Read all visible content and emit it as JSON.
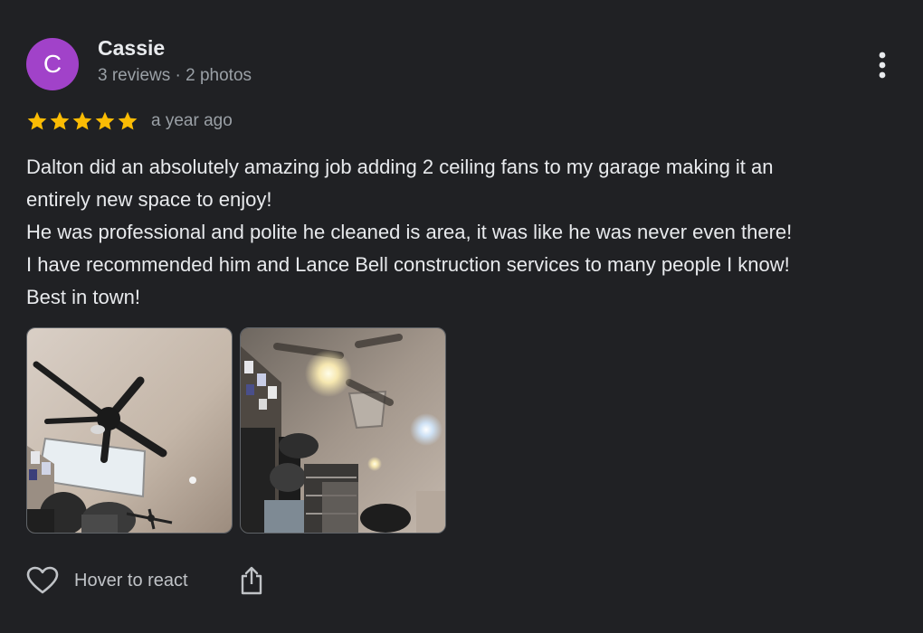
{
  "review": {
    "avatar_letter": "C",
    "avatar_color": "#a142c9",
    "reviewer_name": "Cassie",
    "reviewer_meta": "3 reviews · 2 photos",
    "rating": 5,
    "rating_max": 5,
    "star_color": "#fbbc04",
    "date": "a year ago",
    "text_lines": [
      "Dalton did an absolutely amazing job adding 2 ceiling fans to my garage making it an",
      "entirely new space to enjoy!",
      "He was professional and polite he cleaned is area, it was like he was never even there!",
      "I have recommended him and Lance Bell construction services to many people I know!",
      "Best in town!"
    ],
    "photos": [
      {
        "subject": "ceiling-fan-photo"
      },
      {
        "subject": "garage-lights-photo"
      }
    ]
  },
  "actions": {
    "react_label": "Hover to react",
    "react_icon": "heart-outline-icon",
    "share_icon": "share-icon"
  },
  "menu_icon": "more-vertical-icon",
  "theme": {
    "background": "#202124",
    "primary_text": "#e8eaed",
    "secondary_text": "#9aa0a6"
  }
}
